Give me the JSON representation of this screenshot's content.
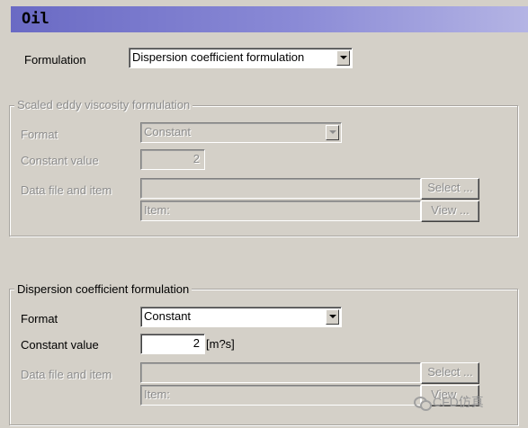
{
  "window": {
    "title": "Oil"
  },
  "formulation": {
    "label": "Formulation",
    "value": "Dispersion coefficient formulation"
  },
  "scaled_eddy": {
    "legend": "Scaled eddy viscosity formulation",
    "format_label": "Format",
    "format_value": "Constant",
    "constant_label": "Constant value",
    "constant_value": "2",
    "datafile_label": "Data file and item",
    "select_button": "Select ...",
    "item_placeholder": "Item:",
    "view_button": "View ..."
  },
  "dispersion": {
    "legend": "Dispersion coefficient formulation",
    "format_label": "Format",
    "format_value": "Constant",
    "constant_label": "Constant value",
    "constant_value": "2",
    "unit": "[m?s]",
    "datafile_label": "Data file and item",
    "select_button": "Select ...",
    "item_placeholder": "Item:",
    "view_button": "View ..."
  },
  "watermark": {
    "text": "CFD仿真",
    "icon": "wechat-icon"
  },
  "colors": {
    "background": "#d4d0c8",
    "title_bar": "#6a6ac4",
    "disabled_text": "#8c8c8c"
  }
}
